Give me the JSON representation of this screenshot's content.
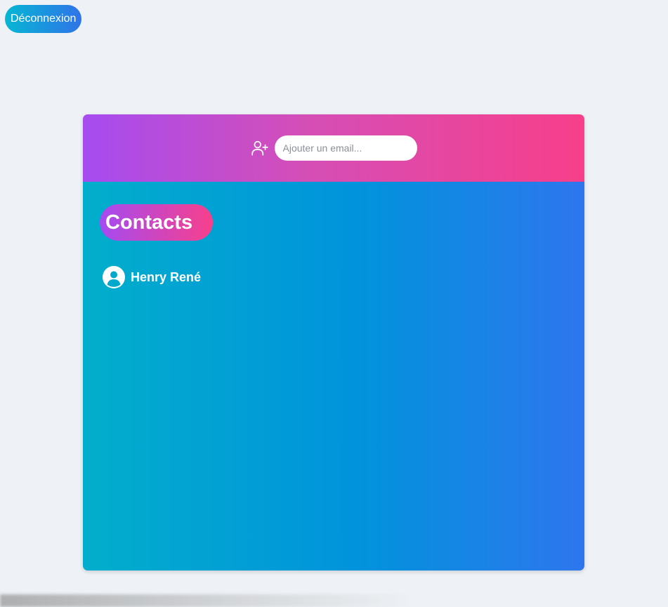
{
  "header": {
    "logout_label": "Déconnexion"
  },
  "card": {
    "add_contact": {
      "icon": "user-plus-icon",
      "placeholder": "Ajouter un email..."
    },
    "contacts_title": "Contacts",
    "contacts": [
      {
        "name": "Henry René",
        "icon": "user-circle-icon"
      }
    ]
  },
  "colors": {
    "page_bg": "#eef2f6",
    "header_gradient": [
      "#a64cf0",
      "#f73f8a"
    ],
    "body_gradient": [
      "#02aecb",
      "#0193dc",
      "#2e76ee"
    ],
    "logout_gradient": [
      "#06b6d4",
      "#2f74e8"
    ]
  }
}
